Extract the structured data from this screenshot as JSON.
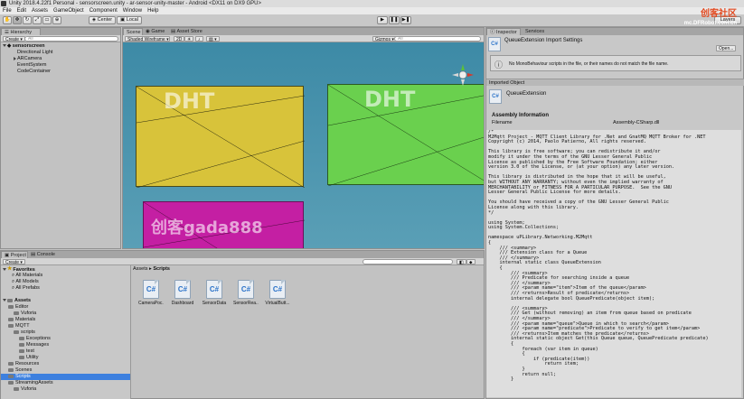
{
  "window": {
    "title": "Unity 2018.4.22f1 Personal - sensorscreen.unity - ar-sensor-unity-master - Android <DX11 on DX9 GPU>"
  },
  "menu": [
    "File",
    "Edit",
    "Assets",
    "GameObject",
    "Component",
    "Window",
    "Help"
  ],
  "toolbar": {
    "pivot_label": "Center",
    "space_label": "Local",
    "layers_label": "Layers"
  },
  "hierarchy": {
    "tab": "Hierarchy",
    "create_label": "Create",
    "search_placeholder": "All",
    "scene_name": "sensorscreen",
    "items": [
      "Directional Light",
      "ARCamera",
      "EventSystem",
      "CodeContainer"
    ]
  },
  "scene": {
    "tabs": [
      "Scene",
      "Game",
      "Asset Store"
    ],
    "shading_mode": "Shaded Wireframe",
    "mode_2d": "2D",
    "gizmos_label": "Gizmos",
    "search_placeholder": "All",
    "card_labels": [
      "DHT",
      "DHT",
      "创客gada888"
    ]
  },
  "inspector": {
    "tabs": [
      "Inspector",
      "Services"
    ],
    "header_title": "QueueExtension Import Settings",
    "open_button": "Open...",
    "warning": "No MonoBehaviour scripts in the file, or their names do not match the file name.",
    "imported_object_label": "Imported Object",
    "object_name": "QueueExtension",
    "assembly_heading": "Assembly Information",
    "filename_label": "Filename",
    "filename_value": "Assembly-CSharp.dll",
    "code_lines": [
      "/*",
      "M2Mqtt Project - MQTT Client Library for .Net and GnatMQ MQTT Broker for .NET",
      "Copyright (c) 2014, Paolo Patierno, All rights reserved.",
      "",
      "This library is free software; you can redistribute it and/or",
      "modify it under the terms of the GNU Lesser General Public",
      "License as published by the Free Software Foundation; either",
      "version 3.0 of the License, or (at your option) any later version.",
      "",
      "This library is distributed in the hope that it will be useful,",
      "but WITHOUT ANY WARRANTY; without even the implied warranty of",
      "MERCHANTABILITY or FITNESS FOR A PARTICULAR PURPOSE.  See the GNU",
      "Lesser General Public License for more details.",
      "",
      "You should have received a copy of the GNU Lesser General Public",
      "License along with this library.",
      "*/",
      "",
      "using System;",
      "using System.Collections;",
      "",
      "namespace uPLibrary.Networking.M2Mqtt",
      "{",
      "    /// <summary>",
      "    /// Extension class for a Queue",
      "    /// </summary>",
      "    internal static class QueueExtension",
      "    {",
      "        /// <summary>",
      "        /// Predicate for searching inside a queue",
      "        /// </summary>",
      "        /// <param name=\"item\">Item of the queue</param>",
      "        /// <returns>Result of predicate</returns>",
      "        internal delegate bool QueuePredicate(object item);",
      "",
      "        /// <summary>",
      "        /// Get (without removing) an item from queue based on predicate",
      "        /// </summary>",
      "        /// <param name=\"queue\">Queue in which to search</param>",
      "        /// <param name=\"predicate\">Predicate to verify to get item</param>",
      "        /// <returns>Item matches the predicate</returns>",
      "        internal static object Get(this Queue queue, QueuePredicate predicate)",
      "        {",
      "            foreach (var item in queue)",
      "            {",
      "                if (predicate(item))",
      "                    return item;",
      "            }",
      "            return null;",
      "        }"
    ]
  },
  "project": {
    "tabs": [
      "Project",
      "Console"
    ],
    "create_label": "Create",
    "favorites": {
      "label": "Favorites",
      "items": [
        "All Materials",
        "All Models",
        "All Prefabs"
      ]
    },
    "assets_label": "Assets",
    "tree": [
      {
        "label": "Editor",
        "indent": 1
      },
      {
        "label": "Vuforia",
        "indent": 2
      },
      {
        "label": "Materials",
        "indent": 1
      },
      {
        "label": "MQTT",
        "indent": 1
      },
      {
        "label": "scripts",
        "indent": 2
      },
      {
        "label": "Exceptions",
        "indent": 3
      },
      {
        "label": "Messages",
        "indent": 3
      },
      {
        "label": "test",
        "indent": 3
      },
      {
        "label": "Utility",
        "indent": 3
      },
      {
        "label": "Resources",
        "indent": 1
      },
      {
        "label": "Scenes",
        "indent": 1
      },
      {
        "label": "Scripts",
        "indent": 1,
        "selected": true
      },
      {
        "label": "StreamingAssets",
        "indent": 1
      },
      {
        "label": "Vuforia",
        "indent": 2
      }
    ],
    "breadcrumb": {
      "root": "Assets",
      "sep": "▸",
      "current": "Scripts"
    },
    "files": [
      "CameraPoc...",
      "Dashboard",
      "SensorData",
      "SensorRea...",
      "VirtualButt..."
    ]
  },
  "watermark": {
    "brand": "创客社区",
    "url": "mc.DFRobot.com.cn"
  }
}
